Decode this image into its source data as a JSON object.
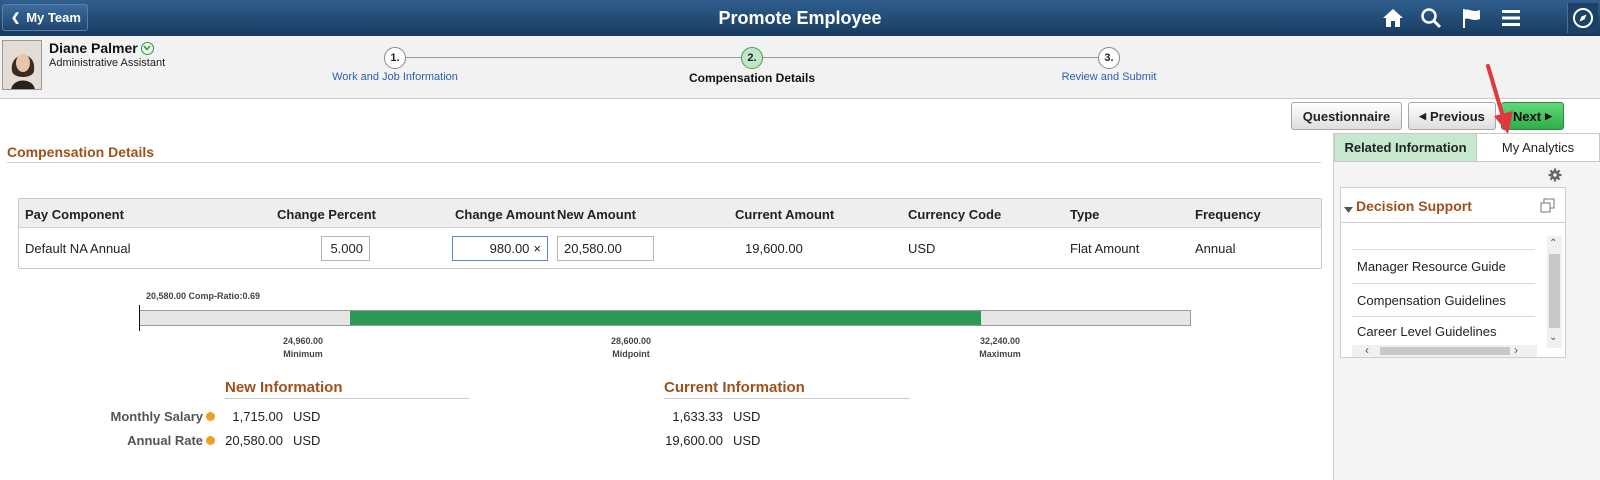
{
  "banner": {
    "back_label": "My Team",
    "title": "Promote Employee",
    "icons": [
      "home-icon",
      "search-icon",
      "flag-icon",
      "menu-icon",
      "navbar-compass-icon"
    ]
  },
  "employee": {
    "name": "Diane Palmer",
    "job_title": "Administrative Assistant"
  },
  "train": {
    "steps": [
      {
        "number": "1.",
        "label": "Work and Job Information",
        "state": "link"
      },
      {
        "number": "2.",
        "label": "Compensation Details",
        "state": "current"
      },
      {
        "number": "3.",
        "label": "Review and Submit",
        "state": "link"
      }
    ]
  },
  "toolbar": {
    "questionnaire_label": "Questionnaire",
    "previous_label": "Previous",
    "next_label": "Next"
  },
  "section": {
    "title": "Compensation Details"
  },
  "grid": {
    "headers": {
      "pay_component": "Pay Component",
      "change_percent": "Change Percent",
      "change_amount": "Change Amount",
      "new_amount": "New Amount",
      "current_amount": "Current Amount",
      "currency_code": "Currency Code",
      "type": "Type",
      "frequency": "Frequency"
    },
    "row": {
      "pay_component": "Default NA Annual",
      "change_percent": "5.000",
      "change_amount": "980.00",
      "new_amount": "20,580.00",
      "current_amount": "19,600.00",
      "currency_code": "USD",
      "type": "Flat Amount",
      "frequency": "Annual"
    }
  },
  "comp_range": {
    "caption": "20,580.00 Comp-Ratio:0.69",
    "minimum": {
      "value": "24,960.00",
      "label": "Minimum"
    },
    "midpoint": {
      "value": "28,600.00",
      "label": "Midpoint"
    },
    "maximum": {
      "value": "32,240.00",
      "label": "Maximum"
    },
    "accent": "#2a9a55"
  },
  "new_info": {
    "title": "New Information",
    "monthly_label": "Monthly Salary",
    "monthly_value": "1,715.00",
    "monthly_currency": "USD",
    "annual_label": "Annual Rate",
    "annual_value": "20,580.00",
    "annual_currency": "USD"
  },
  "current_info": {
    "title": "Current Information",
    "monthly_value": "1,633.33",
    "monthly_currency": "USD",
    "annual_value": "19,600.00",
    "annual_currency": "USD"
  },
  "right_panel": {
    "tab_related": "Related Information",
    "tab_analytics": "My Analytics",
    "ds_title": "Decision Support",
    "ds_items": [
      "Manager Resource Guide",
      "Compensation Guidelines",
      "Career Level Guidelines"
    ]
  }
}
